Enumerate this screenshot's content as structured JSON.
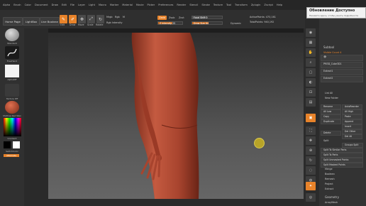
{
  "menu": [
    "Alpha",
    "Brush",
    "Color",
    "Document",
    "Draw",
    "Edit",
    "File",
    "Layer",
    "Light",
    "Macro",
    "Marker",
    "Material",
    "Movie",
    "Picker",
    "Preferences",
    "Render",
    "Stencil",
    "Stroke",
    "Texture",
    "Tool",
    "Transform",
    "Zplugin",
    "Zscript",
    "Help"
  ],
  "subtitle": "ZBrush 2023.2.0.0",
  "topshelf": {
    "home_page": "Home Page",
    "lightbox": "LightBox",
    "live_boolean": "Live Boolean",
    "edit": "Edit",
    "draw": "Draw",
    "move": "Move",
    "scale": "Scale",
    "rotate": "Rotate",
    "mrgb": "Mrgb",
    "rgb": "Rgb",
    "m": "M",
    "zadd": "Zadd",
    "zsub": "Zsub",
    "zcut": "Zcut",
    "focal_shift_label": "Focal Shift",
    "focal_shift_value": "0",
    "draw_size_label": "Draw Size",
    "draw_size_value": "64",
    "z_intensity_label": "Z Intensity",
    "z_intensity_value": "25",
    "rgb_intensity_label": "Rgb Intensity",
    "dynamic_label": "Dynamic",
    "active_points": "ActivePoints: 470,161",
    "total_points": "TotalPoints: 940,192"
  },
  "progress": {
    "focal_shift": 0.5,
    "draw_size": 0.55,
    "z_intensity": 0.6,
    "rgb_intensity": 0.5
  },
  "left": {
    "standard_label": "Standard",
    "freehand_label": "FreeHand",
    "alpha_off_label": "AlphaOff",
    "texture_off_label": "Texture Off",
    "matcap_label": "MatCap Red Wax",
    "gradient_label": "Gradient",
    "switch_color_label": "SwitchColor",
    "alternate_label": "Alternate"
  },
  "update": {
    "title": "Обновление Доступно",
    "subtitle": "Нажмите здесь, чтобы узнать подробности"
  },
  "right_panel": {
    "subtool_title": "Subtool",
    "visible_count": "Visible Count 4",
    "items": [
      "PM3D_Cube3D1",
      "Extract1",
      "Extract2"
    ],
    "list_all": "List All",
    "new_folder": "New Folder",
    "rename": "Rename",
    "auto_reorder": "AutoReorder",
    "all_low": "All Low",
    "all_high": "All High",
    "copy": "Copy",
    "paste": "Paste",
    "duplicate": "Duplicate",
    "append": "Append",
    "insert": "Insert",
    "del_other": "Del Other",
    "delete": "Delete",
    "del_all": "Del All",
    "split": "Split",
    "groups_split": "Groups Split",
    "split_to_similar": "Split To Similar Parts",
    "split_to_parts": "Split To Parts",
    "split_unmasked": "Split Unmasked Points",
    "split_masked": "Split Masked Points",
    "merge": "Merge",
    "boolean": "Boolean",
    "remesh": "Remesh",
    "project": "Project",
    "extract": "Extract",
    "geometry": "Geometry",
    "array_mesh": "ArrayMesh"
  },
  "colors": {
    "accent": "#e8832a",
    "skin": "#b5503a",
    "canvas": "#4a4a4a"
  }
}
